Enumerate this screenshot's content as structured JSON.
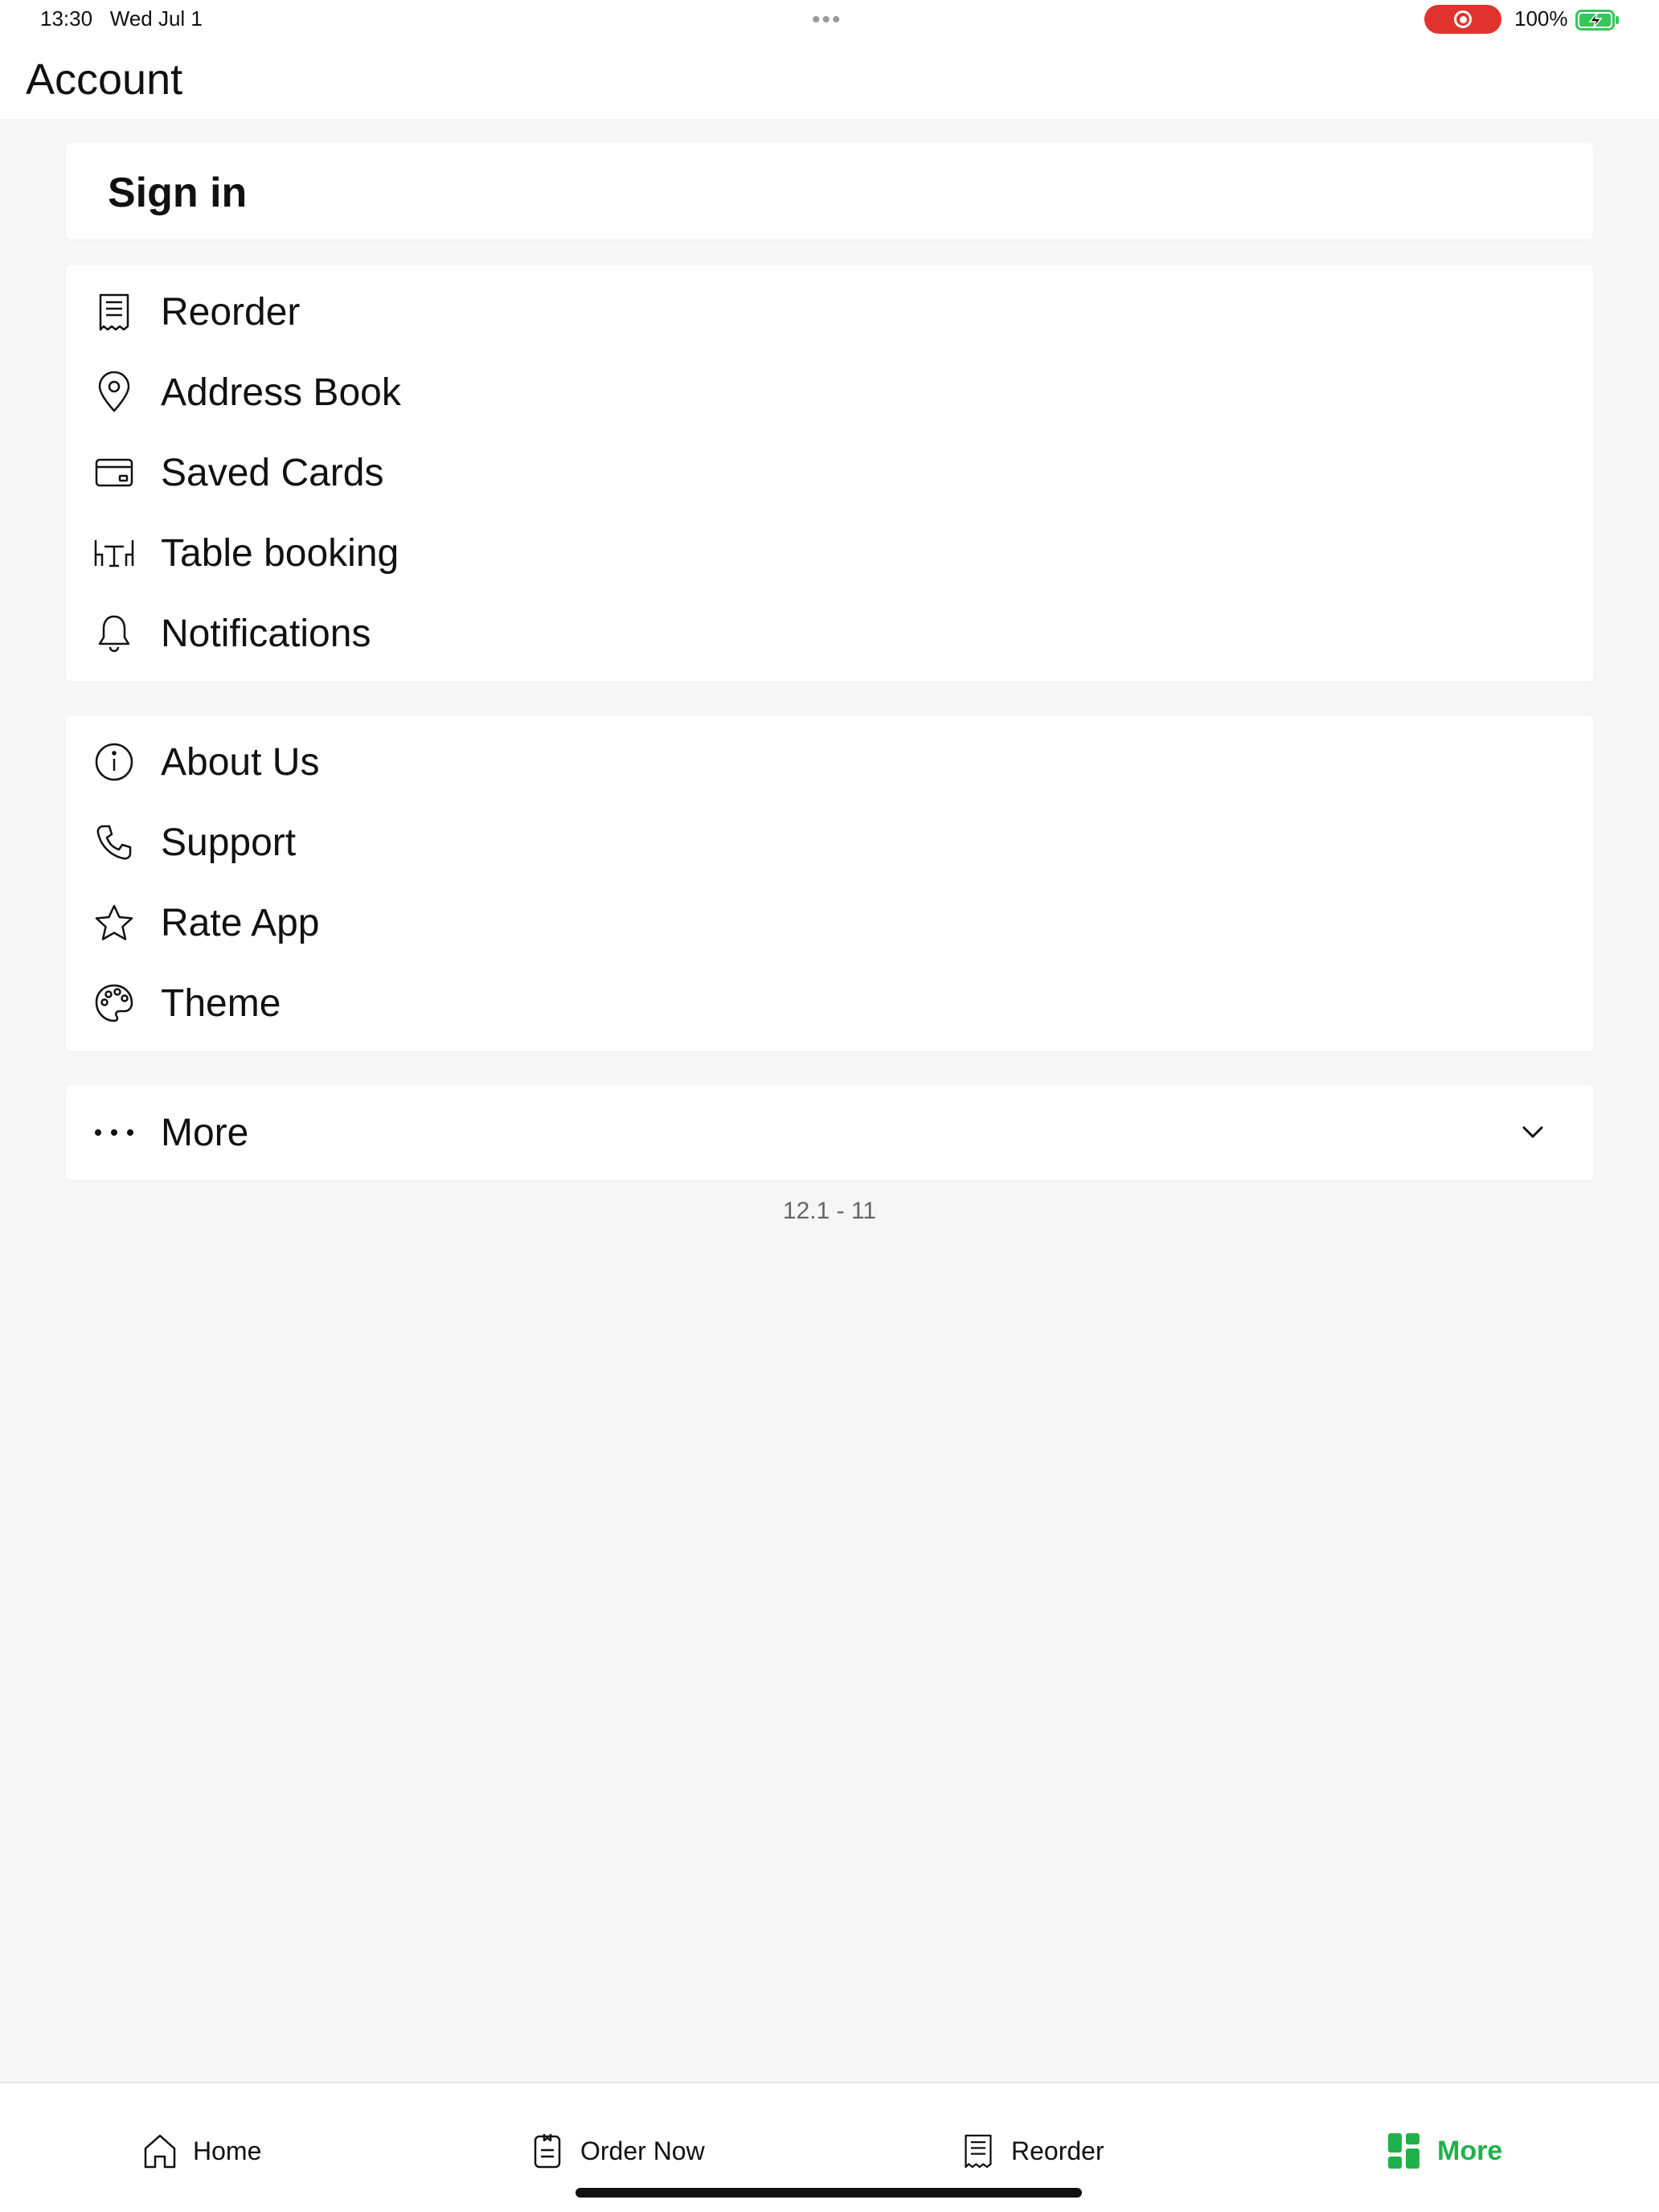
{
  "status_bar": {
    "time": "13:30",
    "date": "Wed Jul 1",
    "dots": "•••",
    "battery_percent": "100%",
    "record_color": "#e0332d",
    "battery_color": "#34c759"
  },
  "header": {
    "title": "Account"
  },
  "signin": {
    "label": "Sign in"
  },
  "menu_group_1": {
    "items": [
      {
        "label": "Reorder",
        "icon": "receipt-icon"
      },
      {
        "label": "Address Book",
        "icon": "location-pin-icon"
      },
      {
        "label": "Saved Cards",
        "icon": "credit-card-icon"
      },
      {
        "label": "Table booking",
        "icon": "table-chairs-icon"
      },
      {
        "label": "Notifications",
        "icon": "bell-icon"
      }
    ]
  },
  "menu_group_2": {
    "items": [
      {
        "label": "About Us",
        "icon": "info-icon"
      },
      {
        "label": "Support",
        "icon": "phone-icon"
      },
      {
        "label": "Rate App",
        "icon": "star-icon"
      },
      {
        "label": "Theme",
        "icon": "palette-icon"
      }
    ]
  },
  "more_section": {
    "label": "More",
    "icon": "ellipsis-icon",
    "expand_icon": "chevron-down-icon"
  },
  "version": "12.1 - 11",
  "tab_bar": {
    "active_color": "#1fb24a",
    "tabs": [
      {
        "label": "Home",
        "icon": "home-icon"
      },
      {
        "label": "Order Now",
        "icon": "order-icon"
      },
      {
        "label": "Reorder",
        "icon": "receipt-icon"
      },
      {
        "label": "More",
        "icon": "grid-icon",
        "active": true
      }
    ]
  }
}
